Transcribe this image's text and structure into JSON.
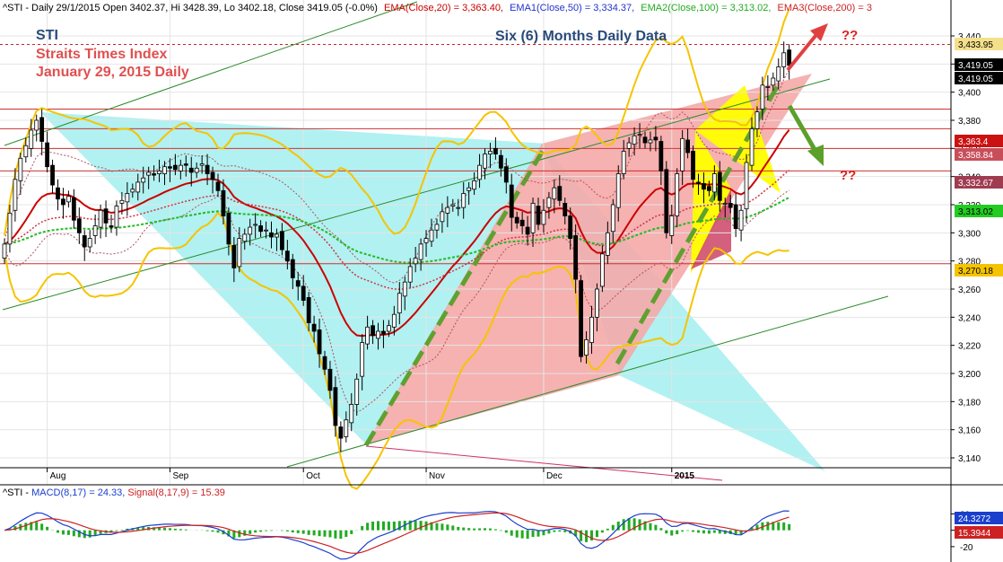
{
  "header": {
    "symbol": "^STI",
    "ohlc_text": "^STI - Daily 29/1/2015 Open 3402.37, Hi 3428.39, Lo 3402.18, Close 3419.05 (-0.0%)",
    "ema20": "EMA(Close,20) = 3,363.40,",
    "ema50": "EMA1(Close,50) = 3,334.37,",
    "ema100": "EMA2(Close,100) = 3,313.02,",
    "ema200": "EMA3(Close,200) = 3"
  },
  "annotations": {
    "sti": "STI",
    "index_name": "Straits Times Index",
    "date_line": "January 29, 2015 Daily",
    "subtitle": "Six (6) Months Daily Data",
    "question_up": "??",
    "question_down": "??"
  },
  "colors": {
    "bull_candle": "#ffffff",
    "bear_candle": "#000000",
    "ema20": "#cc0000",
    "ema50": "#cc3344",
    "ema100": "#22bb22",
    "bollinger": "#f5c400",
    "pattern_cyan": "#9feeee",
    "pattern_pink": "#f5aaaa",
    "pattern_yellow": "#ffff00",
    "pattern_darkpink": "#cc4466",
    "trend_green": "#60a030",
    "support_red": "#cc2222",
    "macd_line": "#1a3fcc",
    "signal_line": "#cc2222",
    "histogram": "#22aa22"
  },
  "chart_data": [
    {
      "type": "line",
      "title": "",
      "x_ticks": [
        "Aug",
        "Sep",
        "Oct",
        "Nov",
        "Dec",
        "2015"
      ],
      "y_ticks": [
        3140,
        3160,
        3180,
        3200,
        3220,
        3240,
        3260,
        3280,
        3300,
        3320,
        3340,
        3360,
        3380,
        3400,
        3420,
        3440
      ],
      "y_tick_labels": [
        "3,140",
        "3,160",
        "3,180",
        "3,200",
        "3,220",
        "3,240",
        "3,260",
        "3,280",
        "3,300",
        "3,320",
        "3,340",
        "3,360",
        "3,380",
        "3,400",
        "3,420",
        "3,440"
      ],
      "ylim": [
        3128,
        3456
      ],
      "grid": true,
      "price_tags": [
        {
          "label": "3,433.95",
          "value": 3433.95,
          "color": "#f5e08a"
        },
        {
          "label": "3,419.05",
          "value": 3419.05,
          "color": "#000000"
        },
        {
          "label": "3,419.05",
          "value": 3419.05,
          "color": "#000000"
        },
        {
          "label": "3,363.4",
          "value": 3363.4,
          "color": "#cc1111"
        },
        {
          "label": "3,358.84",
          "value": 3358.84,
          "color": "#c84f5a"
        },
        {
          "label": "3,332.67",
          "value": 3332.67,
          "color": "#a03c50"
        },
        {
          "label": "3,313.02",
          "value": 3313.02,
          "color": "#22cc22"
        },
        {
          "label": "3,270.18",
          "value": 3270.18,
          "color": "#f5c400"
        }
      ],
      "horizontal_levels": [
        3433.95,
        3388,
        3374,
        3360,
        3344,
        3278
      ],
      "series": [
        {
          "name": "^STI",
          "close": [
            3292,
            3314,
            3338,
            3353,
            3362,
            3373,
            3380,
            3365,
            3347,
            3334,
            3324,
            3320,
            3326,
            3309,
            3300,
            3290,
            3296,
            3305,
            3316,
            3307,
            3304,
            3319,
            3323,
            3328,
            3331,
            3336,
            3339,
            3343,
            3341,
            3344,
            3347,
            3346,
            3345,
            3348,
            3348,
            3343,
            3346,
            3349,
            3342,
            3338,
            3330,
            3312,
            3292,
            3275,
            3296,
            3299,
            3304,
            3306,
            3301,
            3302,
            3297,
            3299,
            3288,
            3280,
            3268,
            3262,
            3252,
            3236,
            3230,
            3214,
            3203,
            3188,
            3163,
            3154,
            3167,
            3178,
            3196,
            3222,
            3233,
            3227,
            3230,
            3228,
            3234,
            3242,
            3257,
            3265,
            3276,
            3282,
            3292,
            3296,
            3302,
            3306,
            3315,
            3318,
            3320,
            3318,
            3328,
            3332,
            3337,
            3348,
            3356,
            3358,
            3356,
            3346,
            3336,
            3311,
            3307,
            3305,
            3299,
            3321,
            3306,
            3316,
            3325,
            3332,
            3323,
            3312,
            3296,
            3267,
            3212,
            3224,
            3240,
            3260,
            3285,
            3300,
            3320,
            3342,
            3358,
            3364,
            3369,
            3370,
            3364,
            3366,
            3366,
            3344,
            3300,
            3312,
            3342,
            3367,
            3357,
            3338,
            3335,
            3331,
            3330,
            3342,
            3323,
            3321,
            3318,
            3303,
            3316,
            3350,
            3374,
            3386,
            3405,
            3404,
            3410,
            3418,
            3428,
            3419
          ]
        }
      ],
      "moving_averages": [
        {
          "name": "EMA(Close,20)",
          "last": 3363.4
        },
        {
          "name": "EMA1(Close,50)",
          "last": 3334.37
        },
        {
          "name": "EMA2(Close,100)",
          "last": 3313.02
        }
      ]
    },
    {
      "type": "bar",
      "title": "",
      "header_text": "^STI - MACD(8,17) = 24.33, Signal(8,17,9) = 15.39",
      "ylim": [
        -30,
        38
      ],
      "y_ticks": [
        -20,
        0,
        20
      ],
      "y_tick_labels": [
        "-20",
        "0",
        "20"
      ],
      "price_tags": [
        {
          "label": "24.3272",
          "value": 24.3272,
          "color": "#1a3fcc"
        },
        {
          "label": "15.3944",
          "value": 15.3944,
          "color": "#cc2222"
        }
      ],
      "series": [
        {
          "name": "MACD(8,17)",
          "last": 24.33
        },
        {
          "name": "Signal(8,17,9)",
          "last": 15.39
        }
      ]
    }
  ]
}
